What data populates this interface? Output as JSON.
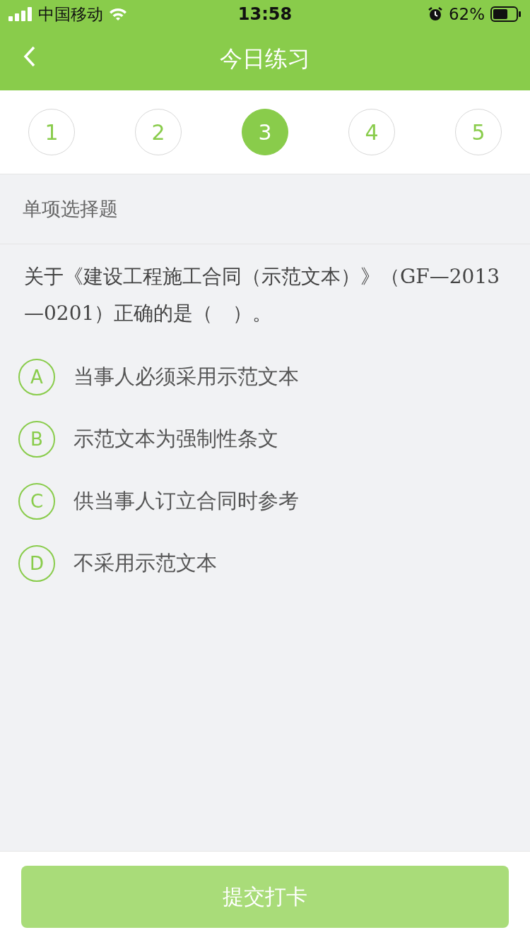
{
  "status_bar": {
    "carrier": "中国移动",
    "time": "13:58",
    "battery": "62%"
  },
  "nav": {
    "title": "今日练习"
  },
  "steps": [
    {
      "label": "1",
      "selected": false
    },
    {
      "label": "2",
      "selected": false
    },
    {
      "label": "3",
      "selected": true
    },
    {
      "label": "4",
      "selected": false
    },
    {
      "label": "5",
      "selected": false
    }
  ],
  "question_type": "单项选择题",
  "question": "关于《建设工程施工合同（示范文本）》（GF—2013—0201）正确的是（　）。",
  "options": [
    {
      "letter": "A",
      "text": "当事人必须采用示范文本",
      "selected": false
    },
    {
      "letter": "B",
      "text": "示范文本为强制性条文",
      "selected": false
    },
    {
      "letter": "C",
      "text": "供当事人订立合同时参考",
      "selected": false
    },
    {
      "letter": "D",
      "text": "不采用示范文本",
      "selected": false
    }
  ],
  "submit": {
    "label": "提交打卡",
    "disabled": true
  }
}
